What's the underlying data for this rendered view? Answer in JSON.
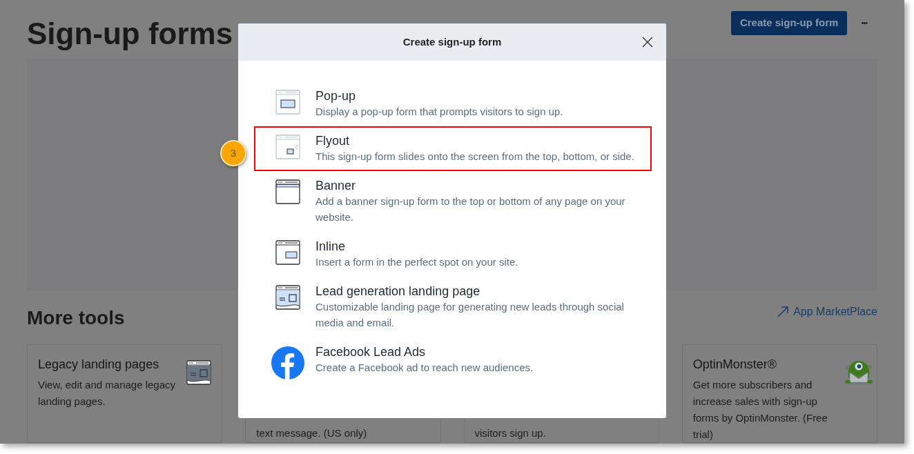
{
  "page": {
    "title": "Sign-up forms",
    "create_button": "Create sign-up form",
    "more_button": "•••",
    "more_tools_title": "More tools",
    "marketplace_link": "App MarketPlace",
    "tools": [
      {
        "kind": "landing",
        "title": "Legacy landing pages",
        "description": "View, edit and manage legacy landing pages."
      },
      {
        "kind": "plain",
        "description": "text message. (US only)"
      },
      {
        "kind": "plain",
        "description": "visitors sign up."
      },
      {
        "kind": "optinmonster",
        "title": "OptinMonster®",
        "description": "Get more subscribers and increase sales with sign-up forms by OptinMonster. (Free trial)"
      }
    ]
  },
  "dialog": {
    "title": "Create sign-up form",
    "options": [
      {
        "kind": "popup",
        "title": "Pop-up",
        "description": "Display a pop-up form that prompts visitors to sign up.",
        "highlighted": false
      },
      {
        "kind": "flyout",
        "title": "Flyout",
        "description": "This sign-up form slides onto the screen from the top, bottom, or side.",
        "highlighted": true
      },
      {
        "kind": "banner",
        "title": "Banner",
        "description": "Add a banner sign-up form to the top or bottom of any page on your website.",
        "highlighted": false
      },
      {
        "kind": "inline",
        "title": "Inline",
        "description": "Insert a form in the perfect spot on your site.",
        "highlighted": false
      },
      {
        "kind": "landing",
        "title": "Lead generation landing page",
        "description": "Customizable landing page for generating new leads through social media and email.",
        "highlighted": false
      },
      {
        "kind": "facebook",
        "title": "Facebook Lead Ads",
        "description": "Create a Facebook ad to reach new audiences.",
        "highlighted": false
      }
    ]
  },
  "annotation": {
    "step": "3"
  }
}
